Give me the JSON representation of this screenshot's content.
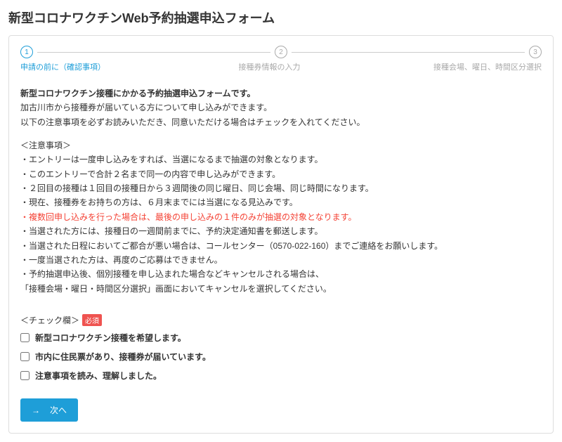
{
  "title": "新型コロナワクチンWeb予約抽選申込フォーム",
  "steps": {
    "s1": {
      "num": "1",
      "label": "申請の前に（確認事項）"
    },
    "s2": {
      "num": "2",
      "label": "接種券情報の入力"
    },
    "s3": {
      "num": "3",
      "label": "接種会場、曜日、時間区分選択"
    }
  },
  "intro": {
    "line1": "新型コロナワクチン接種にかかる予約抽選申込フォームです。",
    "line2": "加古川市から接種券が届いている方について申し込みができます。",
    "line3": "以下の注意事項を必ずお読みいただき、同意いただける場合はチェックを入れてください。"
  },
  "notes_title": "＜注意事項＞",
  "notes": [
    "・エントリーは一度申し込みをすれば、当選になるまで抽選の対象となります。",
    "・このエントリーで合計２名まで同一の内容で申し込みができます。",
    "・２回目の接種は１回目の接種日から３週間後の同じ曜日、同じ会場、同じ時間になります。",
    "・現在、接種券をお持ちの方は、６月末までには当選になる見込みです。",
    "・複数回申し込みを行った場合は、最後の申し込みの１件のみが抽選の対象となります。",
    "・当選された方には、接種日の一週間前までに、予約決定通知書を郵送します。",
    "・当選された日程においてご都合が悪い場合は、コールセンター（0570-022-160）までご連絡をお願いします。",
    "・一度当選された方は、再度のご応募はできません。",
    "・予約抽選申込後、個別接種を申し込まれた場合などキャンセルされる場合は、",
    "「接種会場・曜日・時間区分選択」画面においてキャンセルを選択してください。"
  ],
  "notes_red_index": 4,
  "check": {
    "title": "＜チェック欄＞",
    "required": "必須",
    "items": [
      "新型コロナワクチン接種を希望します。",
      "市内に住民票があり、接種券が届いています。",
      "注意事項を読み、理解しました。"
    ]
  },
  "next": {
    "arrow": "→",
    "label": "次へ"
  }
}
